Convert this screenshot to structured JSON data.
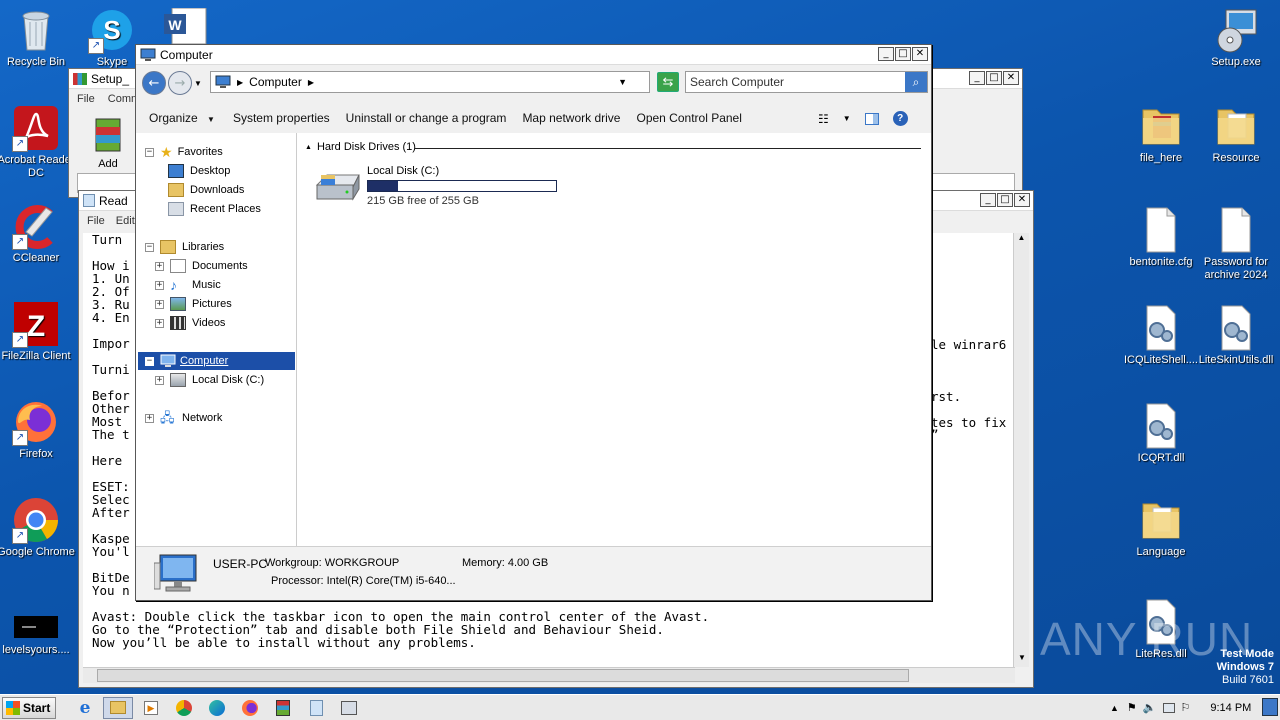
{
  "desktop": {
    "left_icons": [
      {
        "label": "Recycle Bin",
        "icon": "recycle-bin-icon"
      },
      {
        "label": "Skype",
        "icon": "skype-icon"
      },
      {
        "label": "Acrobat Reader DC",
        "icon": "acrobat-icon"
      },
      {
        "label": "CCleaner",
        "icon": "ccleaner-icon"
      },
      {
        "label": "FileZilla Client",
        "icon": "filezilla-icon"
      },
      {
        "label": "Firefox",
        "icon": "firefox-icon"
      },
      {
        "label": "Google Chrome",
        "icon": "chrome-icon"
      },
      {
        "label": "levelsyours....",
        "icon": "black-image-icon"
      }
    ],
    "right_icons": [
      {
        "label": "Setup.exe",
        "icon": "setup-exe-icon"
      },
      {
        "label": "file_here",
        "icon": "folder-icon"
      },
      {
        "label": "Resource",
        "icon": "folder-icon"
      },
      {
        "label": "bentonite.cfg",
        "icon": "file-icon"
      },
      {
        "label": "Password for archive 2024",
        "icon": "file-icon"
      },
      {
        "label": "ICQLiteShell....",
        "icon": "dll-icon"
      },
      {
        "label": "LiteSkinUtils.dll",
        "icon": "dll-icon"
      },
      {
        "label": "ICQRT.dll",
        "icon": "dll-icon"
      },
      {
        "label": "Language",
        "icon": "folder-icon"
      },
      {
        "label": "LiteRes.dll",
        "icon": "dll-icon"
      }
    ],
    "watermark": {
      "brand": "ANY RUN",
      "mode": "Test Mode",
      "os": "Windows 7",
      "build": "Build 7601"
    }
  },
  "setup_window": {
    "title": "Setup_",
    "menu_file": "File",
    "menu_comm": "Comm",
    "add_label": "Add"
  },
  "notepad": {
    "title": "Read",
    "menu_file": "File",
    "menu_edit": "Edit",
    "lines": [
      "Turn ",
      "",
      "How i",
      "1. Un",
      "2. Of",
      "3. Ru",
      "4. En",
      "",
      "Impor",
      "",
      "Turni",
      "",
      "Befor",
      "Other",
      "Most ",
      "The t",
      "",
      "Here ",
      "",
      "ESET:",
      "Selec",
      "After",
      "",
      "Kaspe",
      "You'l",
      "",
      "BitDe",
      "You n",
      "",
      "Avast: Double click the taskbar icon to open the main control center of the Avast.",
      "Go to the “Protection” tab and disable both File Shield and Behaviour Sheid.",
      "Now you’ll be able to install without any problems."
    ],
    "right_fragments": [
      "le winrar6",
      "rst.",
      "tes to fix",
      "”"
    ]
  },
  "explorer": {
    "title": "Computer",
    "address": "Computer",
    "search_placeholder": "Search Computer",
    "commands": [
      "Organize",
      "System properties",
      "Uninstall or change a program",
      "Map network drive",
      "Open Control Panel"
    ],
    "nav": {
      "favorites": "Favorites",
      "desktop": "Desktop",
      "downloads": "Downloads",
      "recent": "Recent Places",
      "libraries": "Libraries",
      "documents": "Documents",
      "music": "Music",
      "pictures": "Pictures",
      "videos": "Videos",
      "computer": "Computer",
      "local_disk": "Local Disk (C:)",
      "network": "Network"
    },
    "group_header": "Hard Disk Drives (1)",
    "drive": {
      "name": "Local Disk (C:)",
      "free_text": "215 GB free of 255 GB",
      "used_fraction": 0.157
    },
    "details": {
      "computer_name": "USER-PC",
      "workgroup": "Workgroup: WORKGROUP",
      "memory": "Memory: 4.00 GB",
      "processor": "Processor: Intel(R) Core(TM) i5-640..."
    }
  },
  "taskbar": {
    "start": "Start",
    "time": "9:14 PM"
  }
}
